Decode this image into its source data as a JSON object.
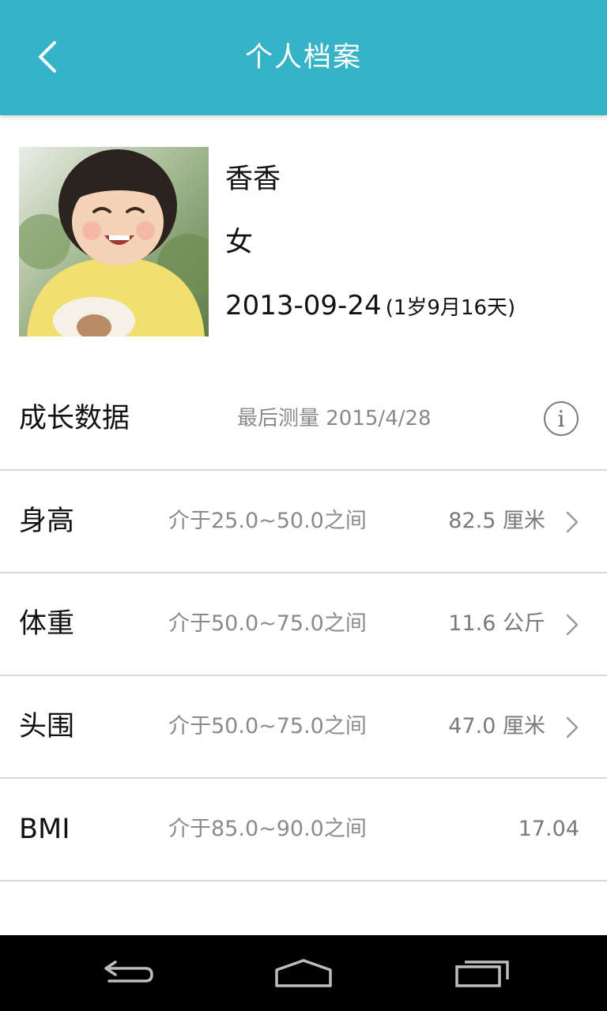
{
  "header": {
    "title": "个人档案",
    "background": "#36b3c6"
  },
  "profile": {
    "name": "香香",
    "gender": "女",
    "birth_date": "2013-09-24",
    "age": "(1岁9月16天)"
  },
  "growth": {
    "title": "成长数据",
    "last_measure": "最后测量 2015/4/28",
    "info_icon": "info-icon"
  },
  "metrics": [
    {
      "label": "身高",
      "range": "介于25.0~50.0之间",
      "value": "82.5 厘米"
    },
    {
      "label": "体重",
      "range": "介于50.0~75.0之间",
      "value": "11.6 公斤"
    },
    {
      "label": "头围",
      "range": "介于50.0~75.0之间",
      "value": "47.0 厘米"
    },
    {
      "label": "BMI",
      "range": "介于85.0~90.0之间",
      "value": "17.04"
    }
  ],
  "navbar": {
    "icons": [
      "back-nav-icon",
      "home-nav-icon",
      "recent-apps-icon"
    ]
  }
}
